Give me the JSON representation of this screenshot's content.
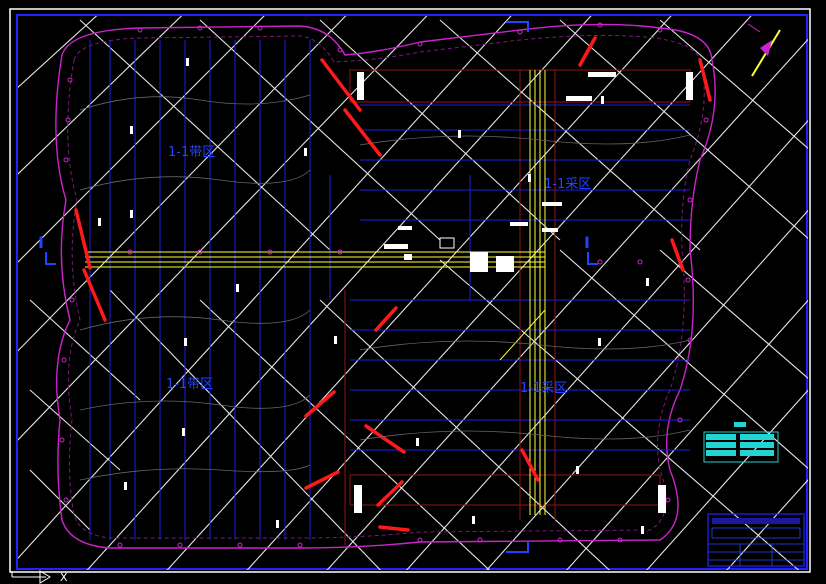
{
  "zone_labels": {
    "upper_left": "1-1带区",
    "lower_left": "1-1带区",
    "upper_right": "1-1采区",
    "lower_right": "1-1采区"
  },
  "section_markers": {
    "left": "I",
    "right": "I"
  },
  "ucs_icon": {
    "axis_x": "X"
  },
  "colors": {
    "background": "#000000",
    "frame": "#2222ff",
    "boundary": "#cc22cc",
    "grid": "#ffffff",
    "panel_lines": "#1e1ee6",
    "roadway_main": "#ffff33",
    "roadway_red": "#ff1a1a",
    "dark_red": "#7a1010",
    "legend": "#22d4d4",
    "text_blue": "#2244ff",
    "block_white": "#ffffff"
  },
  "icons": {
    "north_arrow": "north-arrow-icon",
    "ucs": "ucs-icon"
  }
}
